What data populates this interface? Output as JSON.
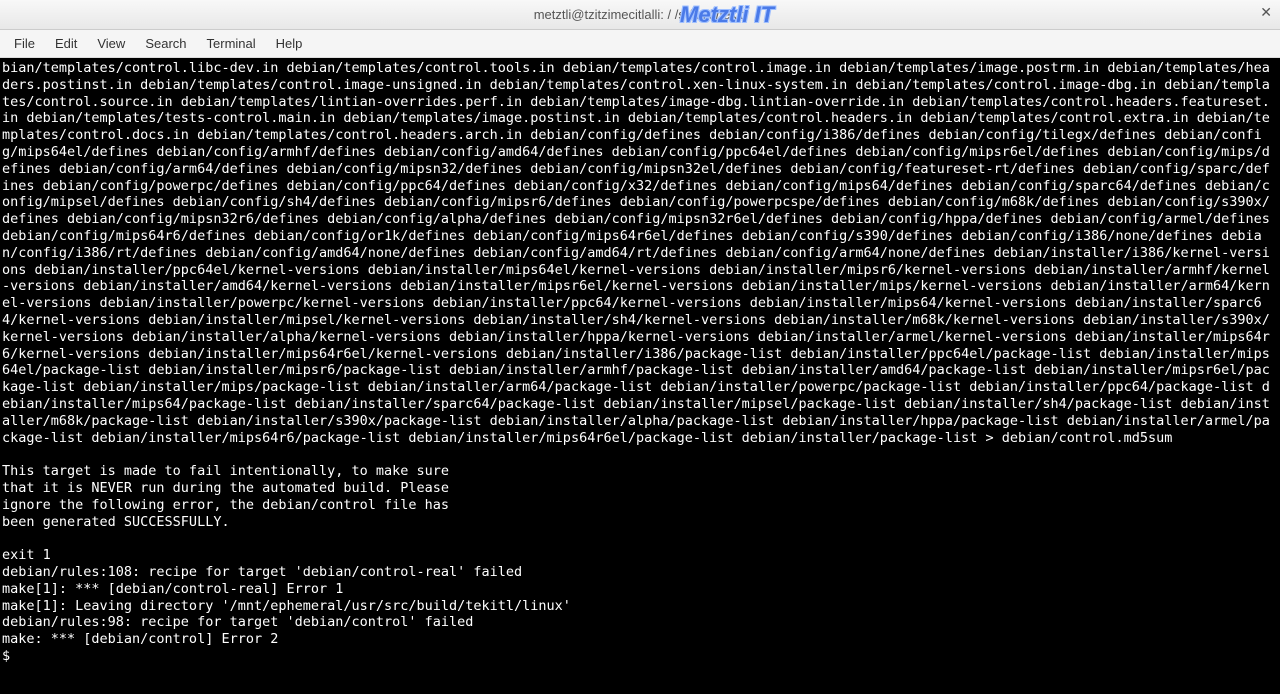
{
  "window": {
    "title": "metztli@tzitzimecitlalli: /                                /s    /    uild/tekitl",
    "watermark": "Metztli IT"
  },
  "menu": {
    "file": "File",
    "edit": "Edit",
    "view": "View",
    "search": "Search",
    "terminal": "Terminal",
    "help": "Help"
  },
  "terminal": {
    "content": "bian/templates/control.libc-dev.in debian/templates/control.tools.in debian/templates/control.image.in debian/templates/image.postrm.in debian/templates/headers.postinst.in debian/templates/control.image-unsigned.in debian/templates/control.xen-linux-system.in debian/templates/control.image-dbg.in debian/templates/control.source.in debian/templates/lintian-overrides.perf.in debian/templates/image-dbg.lintian-override.in debian/templates/control.headers.featureset.in debian/templates/tests-control.main.in debian/templates/image.postinst.in debian/templates/control.headers.in debian/templates/control.extra.in debian/templates/control.docs.in debian/templates/control.headers.arch.in debian/config/defines debian/config/i386/defines debian/config/tilegx/defines debian/config/mips64el/defines debian/config/armhf/defines debian/config/amd64/defines debian/config/ppc64el/defines debian/config/mipsr6el/defines debian/config/mips/defines debian/config/arm64/defines debian/config/mipsn32/defines debian/config/mipsn32el/defines debian/config/featureset-rt/defines debian/config/sparc/defines debian/config/powerpc/defines debian/config/ppc64/defines debian/config/x32/defines debian/config/mips64/defines debian/config/sparc64/defines debian/config/mipsel/defines debian/config/sh4/defines debian/config/mipsr6/defines debian/config/powerpcspe/defines debian/config/m68k/defines debian/config/s390x/defines debian/config/mipsn32r6/defines debian/config/alpha/defines debian/config/mipsn32r6el/defines debian/config/hppa/defines debian/config/armel/defines debian/config/mips64r6/defines debian/config/or1k/defines debian/config/mips64r6el/defines debian/config/s390/defines debian/config/i386/none/defines debian/config/i386/rt/defines debian/config/amd64/none/defines debian/config/amd64/rt/defines debian/config/arm64/none/defines debian/installer/i386/kernel-versions debian/installer/ppc64el/kernel-versions debian/installer/mips64el/kernel-versions debian/installer/mipsr6/kernel-versions debian/installer/armhf/kernel-versions debian/installer/amd64/kernel-versions debian/installer/mipsr6el/kernel-versions debian/installer/mips/kernel-versions debian/installer/arm64/kernel-versions debian/installer/powerpc/kernel-versions debian/installer/ppc64/kernel-versions debian/installer/mips64/kernel-versions debian/installer/sparc64/kernel-versions debian/installer/mipsel/kernel-versions debian/installer/sh4/kernel-versions debian/installer/m68k/kernel-versions debian/installer/s390x/kernel-versions debian/installer/alpha/kernel-versions debian/installer/hppa/kernel-versions debian/installer/armel/kernel-versions debian/installer/mips64r6/kernel-versions debian/installer/mips64r6el/kernel-versions debian/installer/i386/package-list debian/installer/ppc64el/package-list debian/installer/mips64el/package-list debian/installer/mipsr6/package-list debian/installer/armhf/package-list debian/installer/amd64/package-list debian/installer/mipsr6el/package-list debian/installer/mips/package-list debian/installer/arm64/package-list debian/installer/powerpc/package-list debian/installer/ppc64/package-list debian/installer/mips64/package-list debian/installer/sparc64/package-list debian/installer/mipsel/package-list debian/installer/sh4/package-list debian/installer/m68k/package-list debian/installer/s390x/package-list debian/installer/alpha/package-list debian/installer/hppa/package-list debian/installer/armel/package-list debian/installer/mips64r6/package-list debian/installer/mips64r6el/package-list debian/installer/package-list > debian/control.md5sum\n\nThis target is made to fail intentionally, to make sure\nthat it is NEVER run during the automated build. Please\nignore the following error, the debian/control file has\nbeen generated SUCCESSFULLY.\n\nexit 1\ndebian/rules:108: recipe for target 'debian/control-real' failed\nmake[1]: *** [debian/control-real] Error 1\nmake[1]: Leaving directory '/mnt/ephemeral/usr/src/build/tekitl/linux'\ndebian/rules:98: recipe for target 'debian/control' failed\nmake: *** [debian/control] Error 2\n$ "
  }
}
